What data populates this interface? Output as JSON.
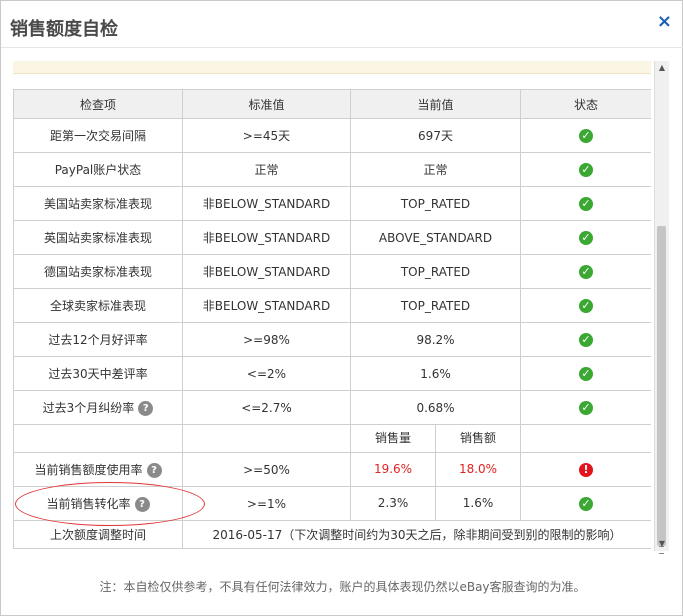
{
  "dialog": {
    "title": "销售额度自检",
    "close_label": "×"
  },
  "table": {
    "headers": [
      "检查项",
      "标准值",
      "当前值",
      "状态"
    ],
    "rows": [
      {
        "item": "距第一次交易间隔",
        "standard": ">=45天",
        "current": "697天"
      },
      {
        "item": "PayPal账户状态",
        "standard": "正常",
        "current": "正常"
      },
      {
        "item": "美国站卖家标准表现",
        "standard": "非BELOW_STANDARD",
        "current": "TOP_RATED"
      },
      {
        "item": "英国站卖家标准表现",
        "standard": "非BELOW_STANDARD",
        "current": "ABOVE_STANDARD"
      },
      {
        "item": "德国站卖家标准表现",
        "standard": "非BELOW_STANDARD",
        "current": "TOP_RATED"
      },
      {
        "item": "全球卖家标准表现",
        "standard": "非BELOW_STANDARD",
        "current": "TOP_RATED"
      },
      {
        "item": "过去12个月好评率",
        "standard": ">=98%",
        "current": "98.2%"
      },
      {
        "item": "过去30天中差评率",
        "standard": "<=2%",
        "current": "1.6%"
      },
      {
        "item": "过去3个月纠纷率",
        "standard": "<=2.7%",
        "current": "0.68%"
      }
    ],
    "subheaders": [
      "销售量",
      "销售额"
    ],
    "usage_row": {
      "item": "当前销售额度使用率",
      "standard": ">=50%",
      "qty": "19.6%",
      "amount": "18.0%"
    },
    "conversion_row": {
      "item": "当前销售转化率",
      "standard": ">=1%",
      "qty": "2.3%",
      "amount": "1.6%"
    },
    "last_adjust": {
      "item": "上次额度调整时间",
      "value": "2016-05-17（下次调整时间约为30天之后，除非期间受到别的限制的影响）"
    }
  },
  "footer_note": "注：本自检仅供参考，不具有任何法律效力，账户的具体表现仍然以eBay客服查询的为准。",
  "colors": {
    "ok": "#3aa832",
    "warn": "#e3141b",
    "highlight": "#e02222"
  }
}
